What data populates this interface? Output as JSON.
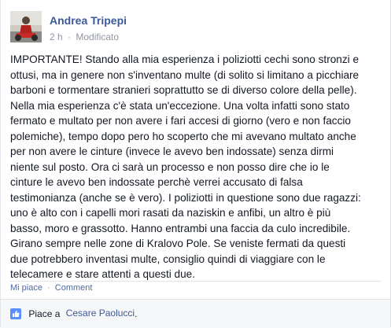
{
  "post": {
    "author": "Andrea Tripepi",
    "time": "2 h",
    "separator": "·",
    "edited": "Modificato",
    "privacy_icon": "audience-icon",
    "lines": [
      "IMPORTANTE! Stando alla mia esperienza i poliziotti cechi sono stronzi e",
      "ottusi, ma in genere non s'inventano multe (di solito si limitano a picchiare",
      "barboni e tormentare stranieri soprattutto se di diverso colore della pelle).",
      "Nella mia esperienza c'è stata un'eccezione. Una volta infatti sono stato",
      "fermato e multato per non avere i fari accesi di giorno (vero e non faccio",
      "polemiche), tempo dopo pero ho scoperto che mi avevano multato anche",
      "per non avere le cinture (invece le avevo ben indossate) senza dirmi",
      "niente sul posto. Ora ci sarà un processo e non posso dire che io le",
      "cinture le avevo ben indossate perchè verrei accusato di falsa",
      "testimonianza (anche se è vero). I poliziotti in questione sono due ragazzi:",
      "uno è alto con i capelli mori rasati da naziskin e anfibi, un altro è più",
      "basso, moro e grassotto. Hanno entrambi una faccia da culo incredibile.",
      "Girano sempre nelle zone di Kralovo Pole. Se veniste fermati da questi",
      "due potrebbero inventasi multe, consiglio quindi di viaggiare con le",
      "telecamere e stare attenti a questi due."
    ]
  },
  "actions": {
    "like": "Mi piace",
    "separator": "·",
    "comment": "Comment"
  },
  "likes": {
    "icon": "thumbs-up-icon",
    "prefix": "Piace a",
    "person": "Cesare Paolucci",
    "suffix": "."
  },
  "colors": {
    "link": "#3b5998",
    "meta": "#9197a3",
    "text": "#141823",
    "footer_bg": "#f6f7f9"
  }
}
